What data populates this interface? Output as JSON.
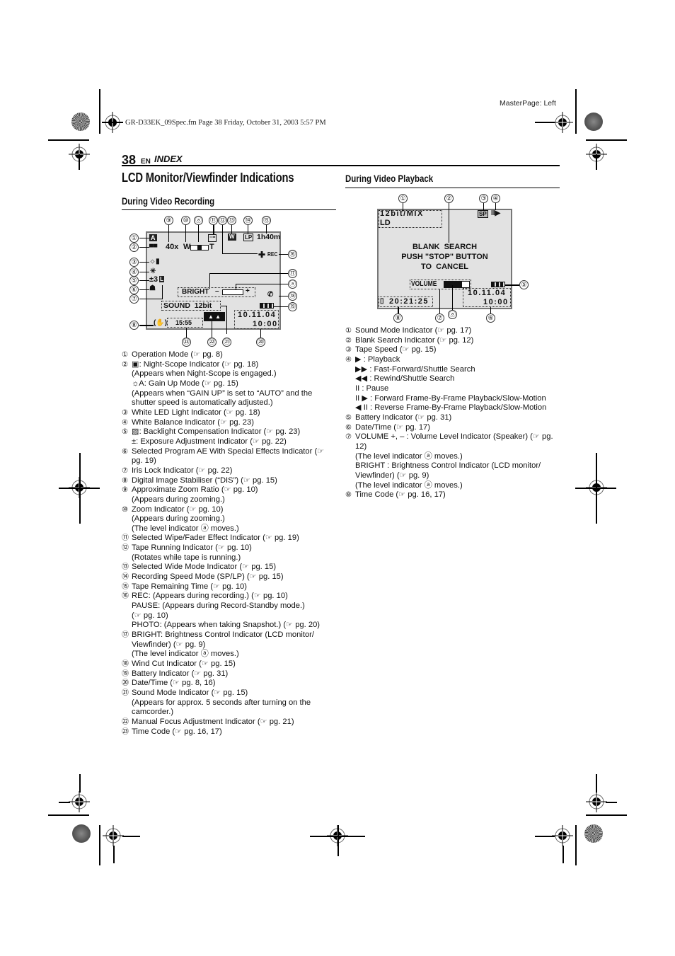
{
  "file_header": "GR-D33EK_09Spec.fm  Page 38  Friday, October 31, 2003  5:57 PM",
  "master_page": "MasterPage: Left",
  "page": {
    "number": "38",
    "lang": "EN",
    "section": "INDEX"
  },
  "title": "LCD Monitor/Viewfinder Indications",
  "recording": {
    "heading": "During Video Recording",
    "lcd": {
      "zoom_ratio": "40x",
      "zoom_w": "W",
      "zoom_t": "T",
      "tape_remaining": "1h40m",
      "speed": "LP",
      "wide": "W",
      "mode": "A",
      "rec": "REC",
      "exposure": "±3",
      "bright_label": "BRIGHT",
      "bright_minus": "–",
      "bright_plus": "+",
      "sound": "SOUND  12bit",
      "date": "10.11.04",
      "time": "10:00",
      "timecode": "15:55",
      "zoom_level_fraction": 0.5
    },
    "callouts_top": [
      "⑨",
      "⑩",
      "ⓐ",
      "⑪",
      "⑫",
      "⑬",
      "⑭",
      "⑮"
    ],
    "callouts_left": [
      "①",
      "②",
      "③",
      "④",
      "⑤",
      "⑥",
      "⑦",
      "⑧"
    ],
    "callouts_right": [
      "⑯",
      "⑰",
      "ⓐ",
      "⑱",
      "⑲"
    ],
    "callouts_bottom": [
      "㉓",
      "㉒",
      "㉑",
      "⑳"
    ],
    "items": [
      {
        "num": "①",
        "lines": [
          "Operation Mode (☞ pg. 8)"
        ]
      },
      {
        "num": "②",
        "lines": [
          "▣: Night-Scope Indicator (☞ pg. 18)",
          "(Appears when Night-Scope is engaged.)",
          "☼A: Gain Up Mode (☞ pg. 15)",
          "(Appears when “GAIN UP” is set to “AUTO” and the shutter speed is automatically adjusted.)"
        ]
      },
      {
        "num": "③",
        "lines": [
          "White LED Light Indicator (☞ pg. 18)"
        ]
      },
      {
        "num": "④",
        "lines": [
          "White Balance Indicator (☞ pg. 23)"
        ]
      },
      {
        "num": "⑤",
        "lines": [
          "▨: Backlight Compensation Indicator (☞ pg. 23)",
          "±: Exposure Adjustment Indicator (☞ pg. 22)"
        ]
      },
      {
        "num": "⑥",
        "lines": [
          "Selected Program AE With Special Effects Indicator (☞ pg. 19)"
        ]
      },
      {
        "num": "⑦",
        "lines": [
          "Iris Lock Indicator (☞ pg. 22)"
        ]
      },
      {
        "num": "⑧",
        "lines": [
          "Digital Image Stabiliser (“DIS”) (☞ pg. 15)"
        ]
      },
      {
        "num": "⑨",
        "lines": [
          "Approximate Zoom Ratio (☞ pg. 10)",
          "(Appears during zooming.)"
        ]
      },
      {
        "num": "⑩",
        "lines": [
          "Zoom Indicator (☞ pg. 10)",
          "(Appears during zooming.)",
          "(The level indicator ⓐ moves.)"
        ]
      },
      {
        "num": "⑪",
        "lines": [
          "Selected Wipe/Fader Effect Indicator (☞ pg. 19)"
        ]
      },
      {
        "num": "⑫",
        "lines": [
          "Tape Running Indicator (☞ pg. 10)",
          "(Rotates while tape is running.)"
        ]
      },
      {
        "num": "⑬",
        "lines": [
          "Selected Wide Mode Indicator (☞ pg. 15)"
        ]
      },
      {
        "num": "⑭",
        "lines": [
          "Recording Speed Mode (SP/LP) (☞ pg. 15)"
        ]
      },
      {
        "num": "⑮",
        "lines": [
          "Tape Remaining Time (☞ pg. 10)"
        ]
      },
      {
        "num": "⑯",
        "lines": [
          "REC: (Appears during recording.) (☞ pg. 10)",
          "PAUSE: (Appears during Record-Standby mode.)",
          "(☞ pg. 10)",
          "PHOTO: (Appears when taking Snapshot.) (☞ pg. 20)"
        ]
      },
      {
        "num": "⑰",
        "lines": [
          "BRIGHT: Brightness Control Indicator (LCD monitor/ Viewfinder) (☞ pg. 9)",
          "(The level indicator ⓐ moves.)"
        ]
      },
      {
        "num": "⑱",
        "lines": [
          "Wind Cut Indicator (☞ pg. 15)"
        ]
      },
      {
        "num": "⑲",
        "lines": [
          "Battery Indicator (☞ pg. 31)"
        ]
      },
      {
        "num": "⑳",
        "lines": [
          "Date/Time (☞ pg. 8, 16)"
        ]
      },
      {
        "num": "㉑",
        "lines": [
          "Sound Mode Indicator (☞ pg. 15)",
          "(Appears for approx. 5 seconds after turning on the camcorder.)"
        ]
      },
      {
        "num": "㉒",
        "lines": [
          "Manual Focus Adjustment Indicator (☞ pg. 21)"
        ]
      },
      {
        "num": "㉓",
        "lines": [
          "Time Code (☞ pg. 16, 17)"
        ]
      }
    ]
  },
  "playback": {
    "heading": "During Video Playback",
    "lcd": {
      "sound_mode": "12bit/MIX",
      "sound_sub": "LD",
      "speed": "SP",
      "transport": "II▶",
      "message_line1": "BLANK  SEARCH",
      "message_line2": "PUSH \"STOP\" BUTTON",
      "message_line3": "TO  CANCEL",
      "volume_label": "VOLUME",
      "volume_level_fraction": 0.7,
      "date": "10.11.04",
      "time": "10:00",
      "timecode": "20:21:25"
    },
    "callouts_top": [
      "①",
      "②",
      "③",
      "④"
    ],
    "callouts_bottom": [
      "⑧",
      "⑦",
      "ⓐ",
      "⑥"
    ],
    "callouts_right": [
      "⑤"
    ],
    "items": [
      {
        "num": "①",
        "lines": [
          "Sound Mode Indicator (☞ pg. 17)"
        ]
      },
      {
        "num": "②",
        "lines": [
          "Blank Search Indicator (☞ pg. 12)"
        ]
      },
      {
        "num": "③",
        "lines": [
          "Tape Speed (☞ pg. 15)"
        ]
      },
      {
        "num": "④",
        "lines": [
          "▶ : Playback",
          "▶▶ : Fast-Forward/Shuttle Search",
          "◀◀ : Rewind/Shuttle Search",
          "II : Pause",
          "II ▶ : Forward Frame-By-Frame Playback/Slow-Motion",
          "◀ II : Reverse Frame-By-Frame Playback/Slow-Motion"
        ]
      },
      {
        "num": "⑤",
        "lines": [
          "Battery Indicator (☞ pg. 31)"
        ]
      },
      {
        "num": "⑥",
        "lines": [
          "Date/Time (☞ pg. 17)"
        ]
      },
      {
        "num": "⑦",
        "lines": [
          "VOLUME +, – : Volume Level Indicator (Speaker) (☞ pg. 12)",
          "(The level indicator ⓐ moves.)",
          "BRIGHT : Brightness Control Indicator (LCD monitor/ Viewfinder) (☞ pg. 9)",
          "(The level indicator ⓐ moves.)"
        ]
      },
      {
        "num": "⑧",
        "lines": [
          "Time Code (☞ pg. 16, 17)"
        ]
      }
    ]
  }
}
